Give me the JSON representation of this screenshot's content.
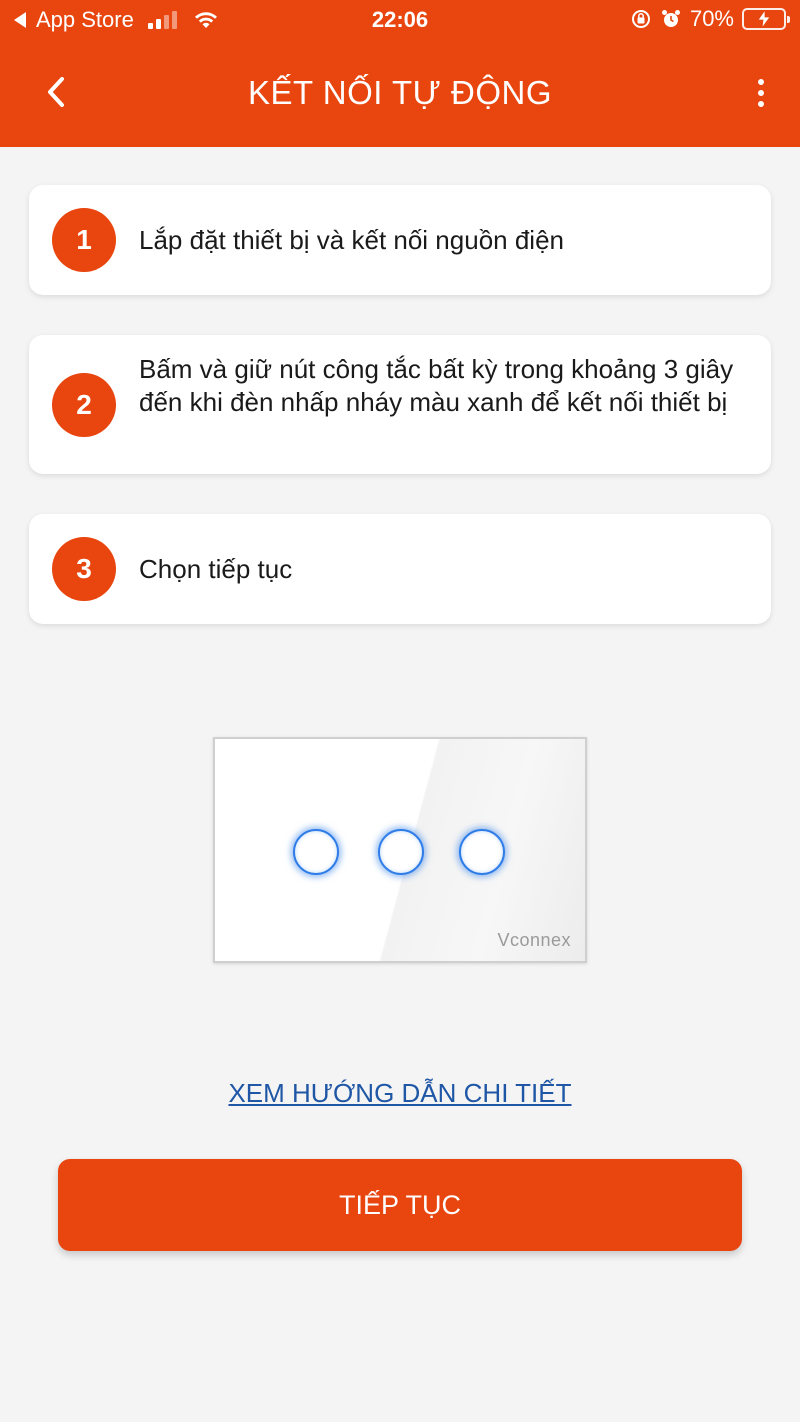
{
  "status_bar": {
    "back_app": "App Store",
    "time": "22:06",
    "battery": "70%",
    "battery_level": 0.7
  },
  "header": {
    "title": "KẾT NỐI TỰ ĐỘNG",
    "back_icon": "chevron-left-icon",
    "more_icon": "more-vertical-icon"
  },
  "steps": [
    {
      "number": "1",
      "text": "Lắp đặt thiết bị và kết nối nguồn điện"
    },
    {
      "number": "2",
      "text": "Bấm và giữ nút công tắc bất kỳ trong khoảng 3 giây đến khi đèn nhấp nháy màu xanh để kết nối thiết bị"
    },
    {
      "number": "3",
      "text": "Chọn tiếp tục"
    }
  ],
  "device_image": {
    "brand": "Vconnex"
  },
  "guide_link": "XEM HƯỚNG DẪN CHI TIẾT",
  "continue_button": "TIẾP TỤC",
  "colors": {
    "accent": "#e8450f",
    "link": "#1f57a6",
    "touch_glow": "#2f7de8"
  }
}
